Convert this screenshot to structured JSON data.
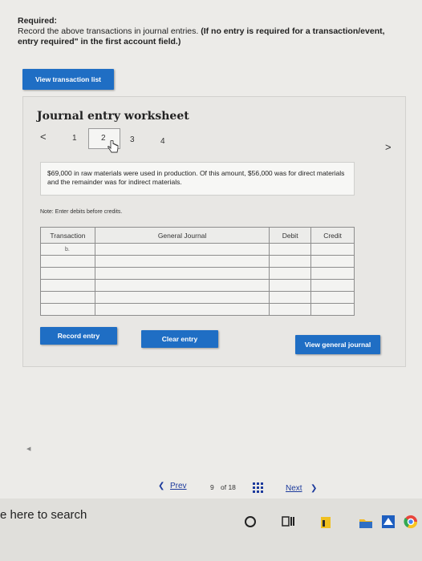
{
  "required": {
    "heading": "Required:",
    "line1": "Record the above transactions in journal entries.",
    "line1_bold": "(If no entry is required for a transaction/event,",
    "line2_bold": "entry required\" in the first account field.)"
  },
  "buttons": {
    "view_transaction_list": "View transaction list",
    "record_entry": "Record entry",
    "clear_entry": "Clear entry",
    "view_general_journal": "View general journal"
  },
  "worksheet": {
    "title": "Journal entry worksheet",
    "steps": [
      "1",
      "2",
      "3",
      "4"
    ],
    "active_step": "2",
    "prev_arrow": "<",
    "next_arrow": ">",
    "description": "$69,000 in raw materials were used in production. Of this amount, $56,000 was for direct materials and the remainder was for indirect materials.",
    "note": "Note: Enter debits before credits."
  },
  "table": {
    "headers": [
      "Transaction",
      "General Journal",
      "Debit",
      "Credit"
    ],
    "rows": [
      [
        "b.",
        "",
        "",
        ""
      ],
      [
        "",
        "",
        "",
        ""
      ],
      [
        "",
        "",
        "",
        ""
      ],
      [
        "",
        "",
        "",
        ""
      ],
      [
        "",
        "",
        "",
        ""
      ],
      [
        "",
        "",
        "",
        ""
      ]
    ]
  },
  "pagination": {
    "prev": "Prev",
    "current": "9",
    "of_label": "of 18",
    "next": "Next"
  },
  "taskbar": {
    "search_text": "e here to search"
  },
  "colors": {
    "button_blue": "#1f6ec4",
    "link_blue": "#1c3a9c"
  }
}
